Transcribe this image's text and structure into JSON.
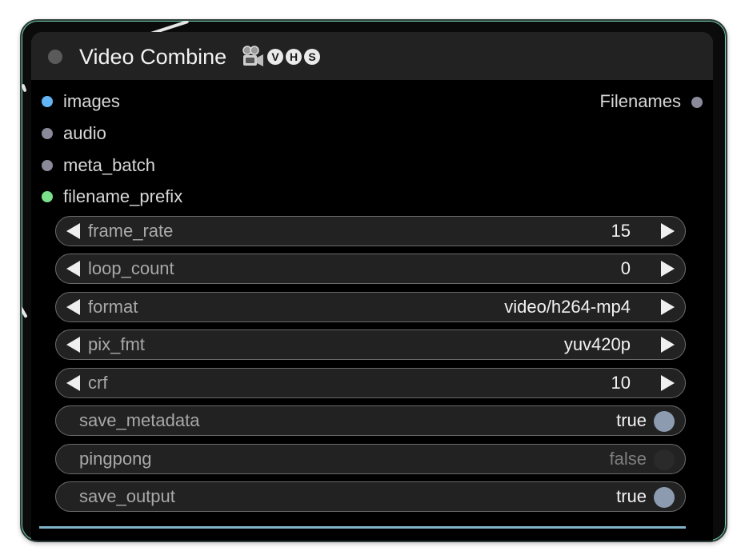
{
  "node": {
    "title": "Video Combine",
    "title_icons": {
      "camera": "movie-camera-icon",
      "badges": [
        "V",
        "H",
        "S"
      ]
    }
  },
  "inputs": [
    {
      "label": "images",
      "color": "#64b5f6"
    },
    {
      "label": "audio",
      "color": "#8a8a9a"
    },
    {
      "label": "meta_batch",
      "color": "#8a8a9a"
    },
    {
      "label": "filename_prefix",
      "color": "#7be08a"
    }
  ],
  "outputs": [
    {
      "label": "Filenames",
      "color": "#8a8a9a"
    }
  ],
  "widgets": {
    "frame_rate": {
      "label": "frame_rate",
      "value": "15"
    },
    "loop_count": {
      "label": "loop_count",
      "value": "0"
    },
    "format": {
      "label": "format",
      "value": "video/h264-mp4"
    },
    "pix_fmt": {
      "label": "pix_fmt",
      "value": "yuv420p"
    },
    "crf": {
      "label": "crf",
      "value": "10"
    },
    "save_metadata": {
      "label": "save_metadata",
      "value": "true"
    },
    "pingpong": {
      "label": "pingpong",
      "value": "false"
    },
    "save_output": {
      "label": "save_output",
      "value": "true"
    }
  },
  "colors": {
    "toggle_on": "#8c9bb0",
    "toggle_off": "#2a2a2a",
    "accent": "#6fd2a8"
  }
}
